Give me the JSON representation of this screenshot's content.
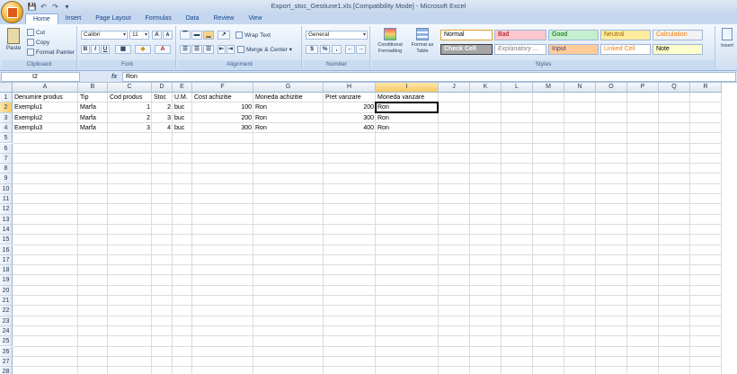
{
  "window": {
    "title": "Export_stoc_Gestiune1.xls  [Compatibility Mode]  -  Microsoft Excel",
    "qat": [
      "💾",
      "↶",
      "↷",
      "▾"
    ]
  },
  "tabs": [
    {
      "label": "Home",
      "active": true
    },
    {
      "label": "Insert"
    },
    {
      "label": "Page Layout"
    },
    {
      "label": "Formulas"
    },
    {
      "label": "Data"
    },
    {
      "label": "Review"
    },
    {
      "label": "View"
    }
  ],
  "ribbon": {
    "clipboard": {
      "label": "Clipboard",
      "paste": "Paste",
      "cut": "Cut",
      "copy": "Copy",
      "format_painter": "Format Painter"
    },
    "font": {
      "label": "Font",
      "name": "Calibri",
      "size": "11",
      "grow": "A",
      "shrink": "A",
      "bold": "B",
      "italic": "I",
      "underline": "U"
    },
    "alignment": {
      "label": "Alignment",
      "wrap": "Wrap Text",
      "merge": "Merge & Center"
    },
    "number": {
      "label": "Number",
      "format": "General",
      "currency": "$",
      "percent": "%",
      "comma": ","
    },
    "styles": {
      "label": "Styles",
      "conditional": "Conditional Formatting",
      "format_table": "Format as Table",
      "cells": [
        {
          "label": "Normal",
          "bg": "#ffffff",
          "fg": "#000000"
        },
        {
          "label": "Bad",
          "bg": "#ffc7ce",
          "fg": "#9c0006"
        },
        {
          "label": "Good",
          "bg": "#c6efce",
          "fg": "#006100"
        },
        {
          "label": "Neutral",
          "bg": "#ffeb9c",
          "fg": "#9c6500"
        },
        {
          "label": "Calculation",
          "bg": "#f2f2f2",
          "fg": "#fa7d00"
        },
        {
          "label": "Check Cell",
          "bg": "#a5a5a5",
          "fg": "#ffffff"
        },
        {
          "label": "Explanatory ...",
          "bg": "#ffffff",
          "fg": "#7f7f7f"
        },
        {
          "label": "Input",
          "bg": "#ffcc99",
          "fg": "#3f3f76"
        },
        {
          "label": "Linked Cell",
          "bg": "#ffffff",
          "fg": "#fa7d00"
        },
        {
          "label": "Note",
          "bg": "#ffffcc",
          "fg": "#000000"
        }
      ]
    },
    "cells_group": {
      "insert": "Insert"
    }
  },
  "formula_bar": {
    "name_box": "I2",
    "fx": "fx",
    "value": "Ron"
  },
  "sheet": {
    "columns": [
      "A",
      "B",
      "C",
      "D",
      "E",
      "F",
      "G",
      "H",
      "I",
      "J",
      "K",
      "L",
      "M",
      "N",
      "O",
      "P",
      "Q",
      "R"
    ],
    "selected_column": "I",
    "selected_row": 2,
    "row_count": 28,
    "rows": [
      [
        "Denumire produs",
        "Tip",
        "Cod produs",
        "Stoc",
        "U.M.",
        "Cost achizitie",
        "Moneda achizitie",
        "Pret vanzare",
        "Moneda vanzare"
      ],
      [
        "Exemplu1",
        "Marfa",
        "1",
        "2",
        "buc",
        "100",
        "Ron",
        "200",
        "Ron"
      ],
      [
        "Exemplu2",
        "Marfa",
        "2",
        "3",
        "buc",
        "200",
        "Ron",
        "300",
        "Ron"
      ],
      [
        "Exemplu3",
        "Marfa",
        "3",
        "4",
        "buc",
        "300",
        "Ron",
        "400",
        "Ron"
      ]
    ],
    "numeric_columns": [
      2,
      3,
      5,
      7
    ]
  }
}
